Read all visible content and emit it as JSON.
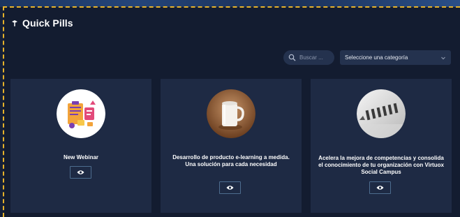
{
  "header": {
    "title": "Quick Pills",
    "icon": "dropper-icon"
  },
  "filters": {
    "search_placeholder": "Buscar ...",
    "category_select": "Seleccione una categoría"
  },
  "cards": [
    {
      "title": "New Webinar",
      "image": "clipboard-illustration",
      "action_icon": "eye-icon"
    },
    {
      "title": "Desarrollo de producto e-learning a medida. Una solución para cada necesidad",
      "image": "mug-photo",
      "action_icon": "eye-icon"
    },
    {
      "title": "Acelera la mejora de competencias y consolida el conocimiento de tu organización con Virtuox Social Campus",
      "image": "numbers-photo",
      "action_icon": "eye-icon"
    }
  ],
  "colors": {
    "background": "#131c30",
    "card": "#1e2a44",
    "input": "#24324e",
    "dashed_border": "#e6b22a",
    "button_border": "#4d6d8f"
  }
}
